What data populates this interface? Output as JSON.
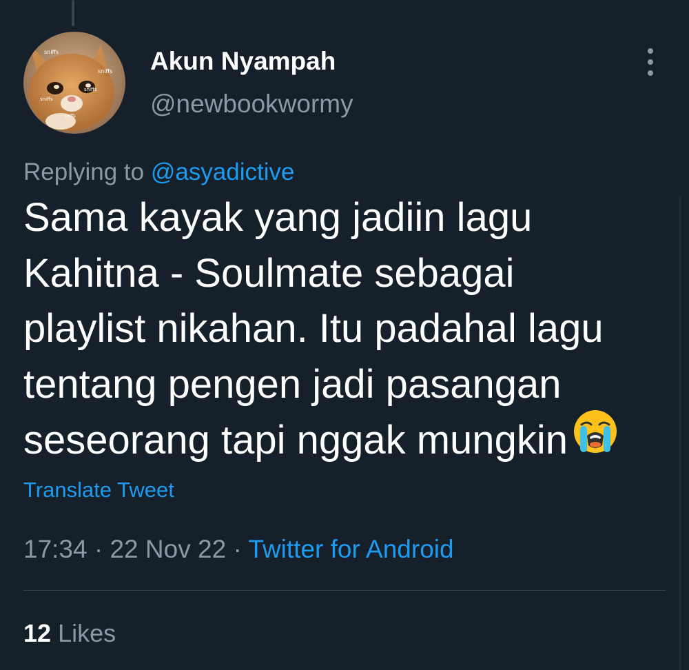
{
  "user": {
    "display_name": "Akun Nyampah",
    "handle": "@newbookwormy",
    "avatar_caption": "sniffs"
  },
  "reply": {
    "prefix": "Replying to",
    "mention": "@asyadictive"
  },
  "tweet": {
    "lines": [
      "Sama kayak yang jadiin lagu",
      "Kahitna - Soulmate sebagai",
      "playlist nikahan. Itu padahal lagu",
      "tentang pengen jadi pasangan",
      "seseorang tapi nggak mungkin"
    ],
    "emoji": "loudly-crying-face"
  },
  "translate_label": "Translate Tweet",
  "meta": {
    "time": "17:34",
    "separator": "·",
    "date": "22 Nov 22",
    "source": "Twitter for Android"
  },
  "stats": {
    "likes_count": "12",
    "likes_label": "Likes"
  },
  "colors": {
    "background": "#15202b",
    "accent": "#1d9bf0",
    "secondary_text": "#8b98a5",
    "divider": "#38444d"
  }
}
